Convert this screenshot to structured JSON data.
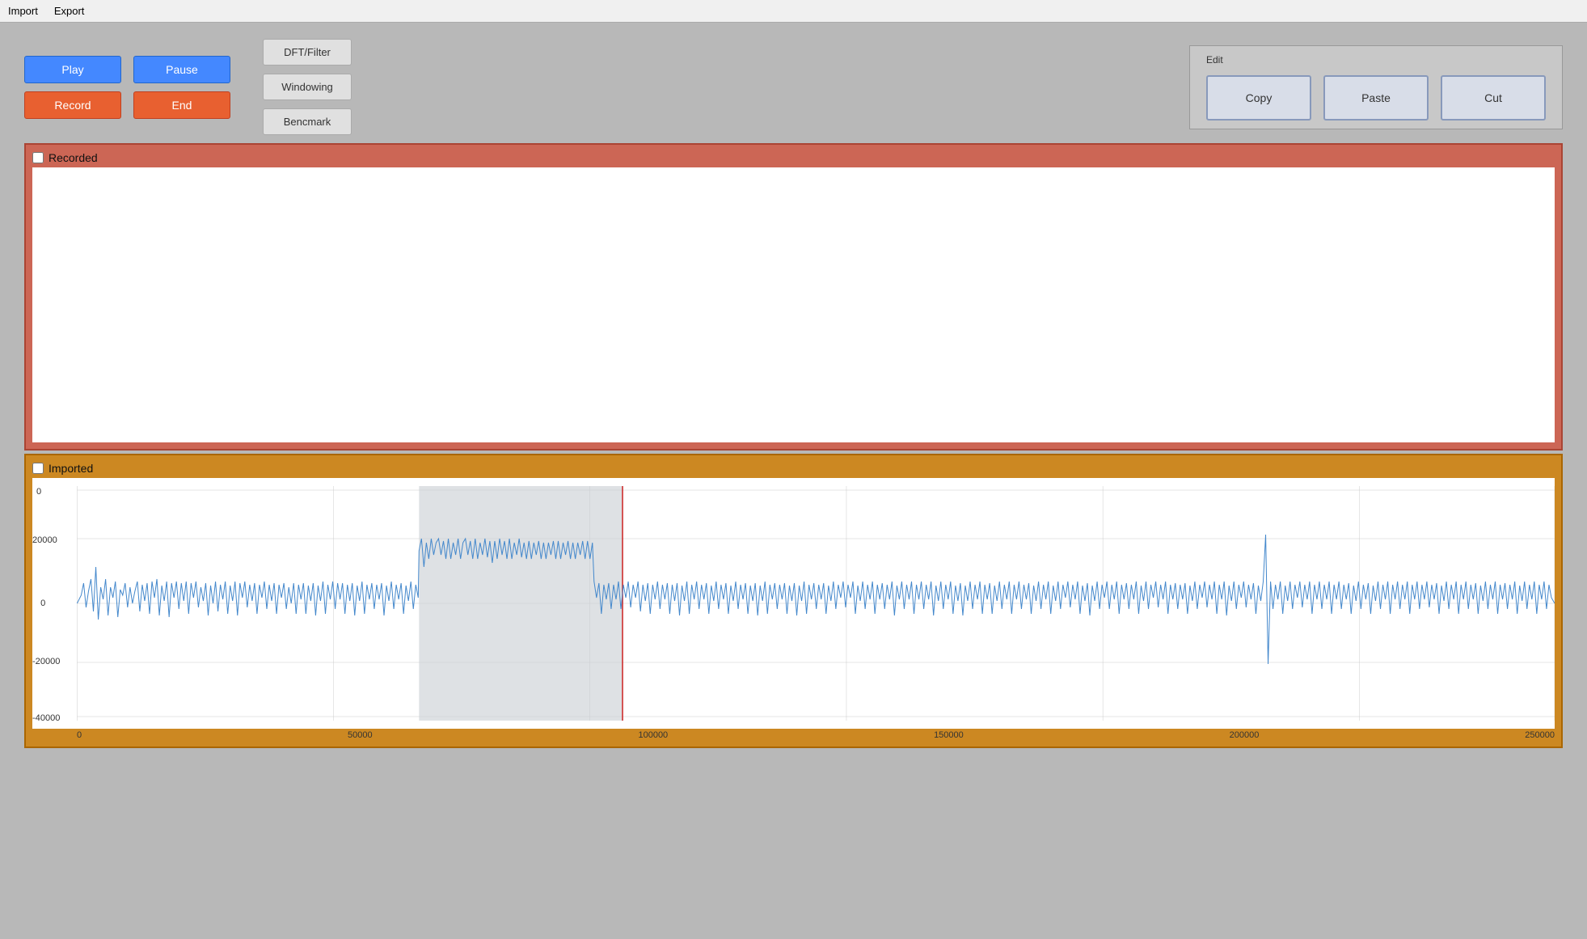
{
  "menu": {
    "items": [
      "Import",
      "Export"
    ]
  },
  "toolbar": {
    "play_label": "Play",
    "pause_label": "Pause",
    "record_label": "Record",
    "end_label": "End",
    "dft_label": "DFT/Filter",
    "windowing_label": "Windowing",
    "benchmark_label": "Bencmark"
  },
  "edit_group": {
    "label": "Edit",
    "copy_label": "Copy",
    "paste_label": "Paste",
    "cut_label": "Cut"
  },
  "recorded_panel": {
    "checkbox_label": "Recorded"
  },
  "imported_panel": {
    "checkbox_label": "Imported",
    "y_labels": [
      "0",
      "20000",
      "0",
      "-20000",
      "-40000"
    ],
    "x_labels": [
      "0",
      "50000",
      "100000",
      "150000",
      "200000",
      "250000"
    ]
  }
}
